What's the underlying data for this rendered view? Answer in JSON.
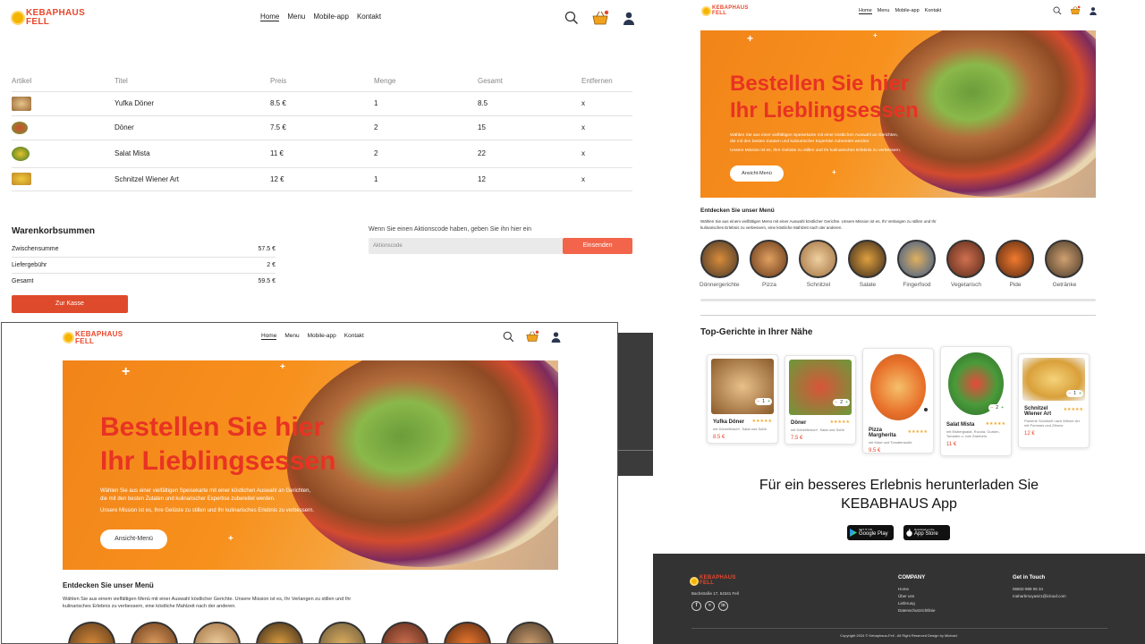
{
  "brand": {
    "line1": "KEBAPHAUS",
    "line2": "FELL"
  },
  "nav": {
    "home": "Home",
    "menu": "Menu",
    "mobile": "Mobile-app",
    "contact": "Kontakt"
  },
  "cart": {
    "headers": [
      "Artikel",
      "Titel",
      "Preis",
      "Menge",
      "Gesamt",
      "Entfernen"
    ],
    "rows": [
      {
        "title": "Yufka Döner",
        "price": "8.5 €",
        "qty": "1",
        "total": "8.5",
        "remove": "x"
      },
      {
        "title": "Döner",
        "price": "7.5 €",
        "qty": "2",
        "total": "15",
        "remove": "x"
      },
      {
        "title": "Salat Mista",
        "price": "11 €",
        "qty": "2",
        "total": "22",
        "remove": "x"
      },
      {
        "title": "Schnitzel Wiener Art",
        "price": "12 €",
        "qty": "1",
        "total": "12",
        "remove": "x"
      }
    ],
    "totals_title": "Warenkorbsummen",
    "subtotal_label": "Zwischensumme",
    "subtotal": "57.5 €",
    "delivery_label": "Liefergebühr",
    "delivery": "2 €",
    "total_label": "Gesamt",
    "total": "59.5 €",
    "checkout": "Zur Kasse",
    "promo_hint": "Wenn Sie einen Aktionscode haben, geben Sie ihn hier ein",
    "promo_placeholder": "Aktionscode",
    "promo_submit": "Einsenden"
  },
  "hero": {
    "line1": "Bestellen Sie hier",
    "line2": "Ihr Lieblingsessen",
    "text1": "Wählen Sie aus einer vielfältigen Speisekarte mit einer köstlichen Auswahl an Gerichten,",
    "text2": "die mit den besten Zutaten und kulinarischer Expertise zubereitet werden.",
    "text3": "Unsere Mission ist es, Ihre Gelüste zu stillen und Ihr kulinarisches Erlebnis zu verbessern.",
    "button": "Ansicht-Menü"
  },
  "explore": {
    "title": "Entdecken Sie unser Menü",
    "text1": "Wählen Sie aus einem vielfältigen Menü mit einer Auswahl köstlicher Gerichte. Unsere Mission ist es, Ihr Verlangen zu stillen und Ihr",
    "text2": "kulinarisches Erlebnis zu verbessern, eine köstliche Mahlzeit nach der anderen.",
    "categories": [
      "Dönnergerichte",
      "Pizza",
      "Schnitzel",
      "Salate",
      "Fingerfood",
      "Vegetarisch",
      "Pide",
      "Getränke"
    ]
  },
  "top": {
    "title": "Top-Gerichte in Ihrer Nähe",
    "dishes": [
      {
        "name": "Yufka Döner",
        "desc": "mit Dönerfleisch*, Salat und Soße",
        "price": "8.5 €",
        "qty": "1"
      },
      {
        "name": "Döner",
        "desc": "mit Dönerfleisch*, Salat und Soße",
        "price": "7.5 €",
        "qty": "2"
      },
      {
        "name": "Pizza Margherita",
        "desc": "mit Käse und Tomatensoße",
        "price": "9.5 €",
        "qty": ""
      },
      {
        "name": "Salat Mista",
        "desc": "mit Eisbergsalat, Rucola, Gurken, Tomaten u. rote Zwiebeln",
        "price": "11 €",
        "qty": "2"
      },
      {
        "name": "Schnitzel Wiener Art",
        "desc": "Panierte Schnitzel nach Wiener Art mit Pommes und Zitrone",
        "price": "12 €",
        "qty": "1"
      }
    ],
    "stars": "★★★★★"
  },
  "app": {
    "title1": "Für ein besseres Erlebnis herunterladen Sie",
    "title2": "KEBABHAUS App",
    "google_small": "GET IT ON",
    "google": "Google Play",
    "apple_small": "Download on the",
    "apple": "App Store"
  },
  "footer": {
    "address": "Bachstraße 17, 54341 Fell",
    "company_title": "COMPANY",
    "company_links": [
      "Home",
      "Über uns",
      "Lieferung",
      "Datenschutzrichtlinie"
    ],
    "touch_title": "Get in Touch",
    "phone": "06502-989 06 34",
    "email": "maharbmoyasir1@icloud.com",
    "copyright": "Copyright 2024 © Kebaphaus-Fell - All Right Reserved Design by Michael."
  }
}
